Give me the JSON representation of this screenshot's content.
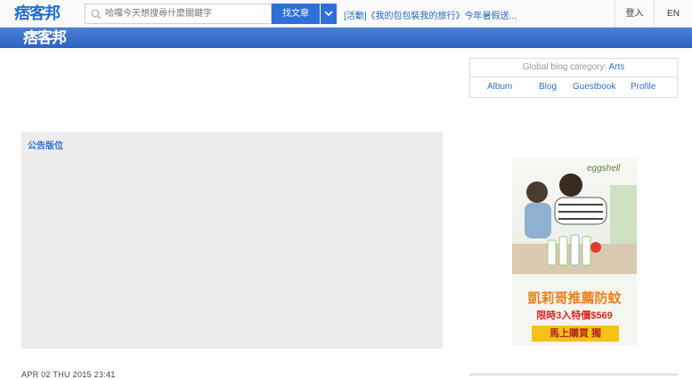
{
  "header": {
    "logo": "痞客邦",
    "search_placeholder": "哈囉今天想搜尋什麼關鍵字",
    "search_button": "找文章",
    "promo_text": "[活動]《我的包包裝我的旅行》今年暑假送...",
    "login": "登入",
    "lang": "EN"
  },
  "banner": {
    "logo": "痞客邦"
  },
  "category": {
    "label": "Global blog category: ",
    "value": "Arts",
    "nav": [
      "Album",
      "Blog",
      "Guestbook",
      "Profile"
    ]
  },
  "bulletin": {
    "title": "公告版位"
  },
  "post": {
    "datetime": "APR 02 THU 2015 23:41"
  },
  "ad": {
    "brand": "eggshell",
    "headline": "凱莉哥推薦防蚊",
    "price": "限時3入特價$569",
    "cta": "馬上購買",
    "badge": "獨"
  }
}
